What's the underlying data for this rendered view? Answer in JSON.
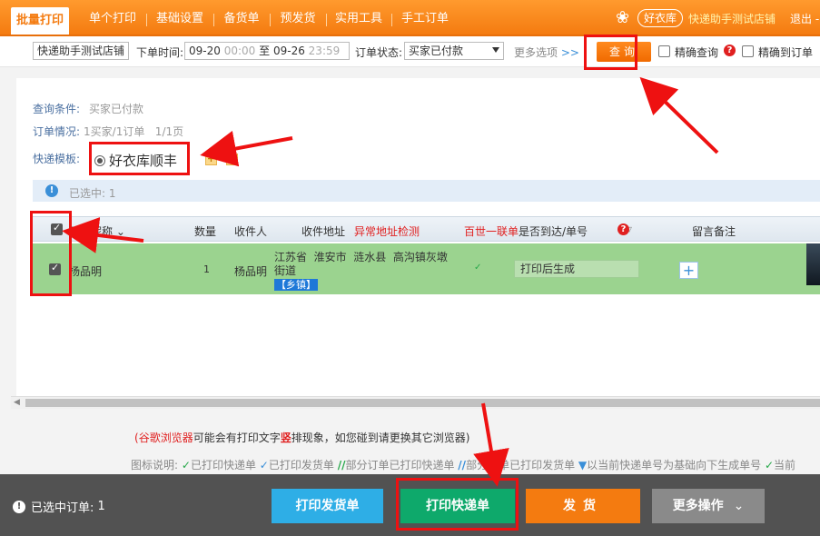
{
  "nav": {
    "tabs": [
      "批量打印",
      "单个打印",
      "基础设置",
      "备货单",
      "预发货",
      "实用工具",
      "手工订单"
    ],
    "brand_name": "好衣库",
    "shop_name": "快递助手测试店铺",
    "logout": "退出 -"
  },
  "search": {
    "shop_select": "快递助手测试店铺",
    "order_time_label": "下单时间:",
    "date_from": "09-20",
    "time_from": "00:00",
    "to": "至",
    "date_to": "09-26",
    "time_to": "23:59",
    "status_label": "订单状态:",
    "status_value": "买家已付款",
    "more_options": "更多选项",
    "more_chevron": ">>",
    "query_button": "查询",
    "exact_query": "精确查询",
    "exact_to_order": "精确到订单"
  },
  "panel": {
    "query_condition_label": "查询条件:",
    "query_condition_value": "买家已付款",
    "order_info_label": "订单情况:",
    "order_info_value": "1买家/1订单   1/1页",
    "template_label": "快递模板:",
    "template_name": "好衣库顺丰",
    "selected_label": "已选中:",
    "selected_count": "1"
  },
  "table": {
    "headers": {
      "buyer": "买家昵称",
      "qty": "数量",
      "receiver": "收件人",
      "address": "收件地址",
      "abnormal": "异常地址检测",
      "baishi": "百世一联单",
      "arrive": "是否到达/单号",
      "remark": "留言备注"
    },
    "row": {
      "buyer": "杨品明",
      "qty": "1",
      "receiver": "杨品明",
      "address_line1": "江苏省  淮安市  涟水县  高沟镇灰墩",
      "address_line2": "街道",
      "address_tag": "【乡镇】",
      "waybill": "打印后生成"
    }
  },
  "notes": {
    "browser_name": "谷歌浏览器",
    "warn_pre": "(",
    "warn_mid": "可能会有打印文字",
    "warn_red": "竖",
    "warn_post": "排现象，如您碰到请更换其它浏览器)",
    "legend_label": "图标说明:",
    "legend_1": "已打印快递单",
    "legend_2": "已打印发货单",
    "legend_3": "部分订单已打印快递单",
    "legend_4": "部分订单已打印发货单",
    "legend_5": "以当前快递单号为基础向下生成单号",
    "legend_6": "当前"
  },
  "bottom": {
    "selected_orders_label": "已选中订单:",
    "selected_orders_count": "1",
    "print_invoice": "打印发货单",
    "print_express": "打印快递单",
    "ship": "发货",
    "more_actions": "更多操作"
  },
  "colors": {
    "nav_orange": "#f47b10",
    "row_green": "#9bd38f",
    "annotation_red": "#e11111",
    "btn_blue": "#2eaee6",
    "btn_green": "#0ea96b"
  }
}
